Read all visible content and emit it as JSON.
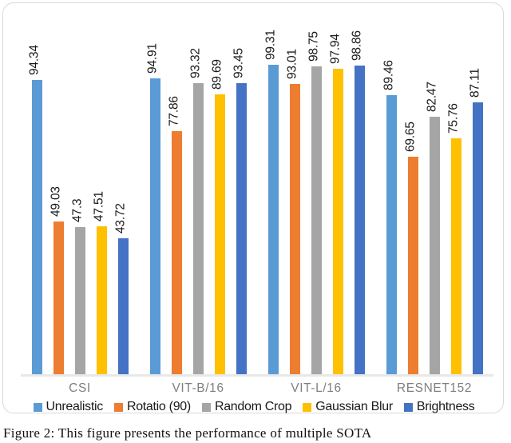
{
  "figure": {
    "caption": "Figure 2: This figure presents the performance of multiple SOTA"
  },
  "legend": {
    "position": "bottom-center",
    "entries": [
      {
        "label": "Unrealistic",
        "color": "#5B9BD5"
      },
      {
        "label": "Rotatio (90)",
        "color": "#ED7D31"
      },
      {
        "label": "Random Crop",
        "color": "#A5A5A5"
      },
      {
        "label": "Gaussian Blur",
        "color": "#FFC000"
      },
      {
        "label": "Brightness",
        "color": "#4472C4"
      }
    ]
  },
  "chart_data": {
    "type": "bar",
    "title": "",
    "xlabel": "",
    "ylabel": "",
    "ylim": [
      0,
      100
    ],
    "grid": false,
    "legend_position": "bottom-center",
    "categories": [
      "CSI",
      "VIT-B/16",
      "VIT-L/16",
      "RESNET152"
    ],
    "series": [
      {
        "name": "Unrealistic",
        "color": "#5B9BD5",
        "values": [
          94.34,
          94.91,
          99.31,
          89.46
        ]
      },
      {
        "name": "Rotatio (90)",
        "color": "#ED7D31",
        "values": [
          49.03,
          77.86,
          93.01,
          69.65
        ]
      },
      {
        "name": "Random Crop",
        "color": "#A5A5A5",
        "values": [
          47.3,
          93.32,
          98.75,
          82.47
        ]
      },
      {
        "name": "Gaussian Blur",
        "color": "#FFC000",
        "values": [
          47.51,
          89.69,
          97.94,
          75.76
        ]
      },
      {
        "name": "Brightness",
        "color": "#4472C4",
        "values": [
          43.72,
          93.45,
          98.86,
          87.11
        ]
      }
    ],
    "data_labels": [
      [
        "94.34",
        "49.03",
        "47.3",
        "47.51",
        "43.72"
      ],
      [
        "94.91",
        "77.86",
        "93.32",
        "89.69",
        "93.45"
      ],
      [
        "99.31",
        "93.01",
        "98.75",
        "97.94",
        "98.86"
      ],
      [
        "89.46",
        "69.65",
        "82.47",
        "75.76",
        "87.11"
      ]
    ]
  }
}
